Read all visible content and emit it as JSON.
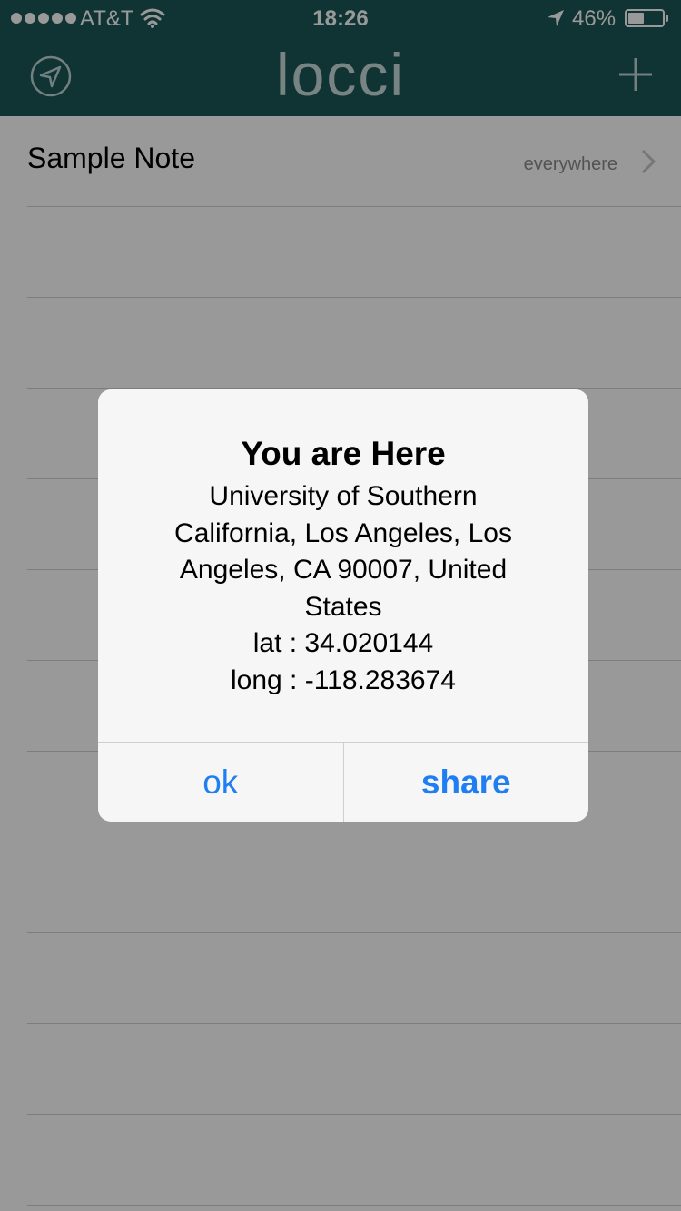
{
  "status_bar": {
    "carrier": "AT&T",
    "time": "18:26",
    "battery_percent": "46%",
    "battery_level": 0.46,
    "signal_icon": "signal-dots-icon",
    "wifi_icon": "wifi-icon",
    "location_icon": "location-arrow-icon"
  },
  "nav": {
    "title": "locci",
    "left_icon": "locate-icon",
    "right_icon": "plus-icon"
  },
  "notes": [
    {
      "title": "Sample Note",
      "scope": "everywhere"
    },
    {
      "title": "",
      "scope": ""
    },
    {
      "title": "",
      "scope": ""
    },
    {
      "title": "",
      "scope": ""
    },
    {
      "title": "",
      "scope": ""
    },
    {
      "title": "",
      "scope": ""
    },
    {
      "title": "",
      "scope": ""
    },
    {
      "title": "",
      "scope": ""
    },
    {
      "title": "",
      "scope": ""
    },
    {
      "title": "",
      "scope": ""
    },
    {
      "title": "",
      "scope": ""
    },
    {
      "title": "",
      "scope": ""
    }
  ],
  "alert": {
    "title": "You are Here",
    "message_lines": [
      "University of Southern",
      "California, Los Angeles, Los",
      "Angeles, CA 90007, United",
      "States",
      "lat : 34.020144",
      "long : -118.283674"
    ],
    "ok_label": "ok",
    "share_label": "share"
  },
  "colors": {
    "nav_background": "#1b5656",
    "overlay": "rgba(0,0,0,0.40)",
    "alert_button": "#1f7ff2"
  }
}
